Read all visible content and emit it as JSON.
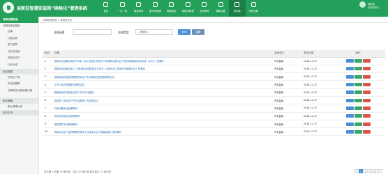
{
  "app": {
    "title": "吴新区智慧安监和“网格化”管理系统"
  },
  "nav": [
    {
      "label": "首页",
      "icon": "home-icon"
    },
    {
      "label": "一企一档",
      "icon": "building-icon"
    },
    {
      "label": "隐患排查",
      "icon": "search-icon"
    },
    {
      "label": "重大危险源",
      "icon": "warning-icon"
    },
    {
      "label": "网格巡查",
      "icon": "grid-icon"
    },
    {
      "label": "网格员管理",
      "icon": "users-icon"
    },
    {
      "label": "安全教育",
      "icon": "book-icon"
    },
    {
      "label": "辅助功能",
      "icon": "tools-icon"
    },
    {
      "label": "知识库",
      "icon": "library-icon",
      "active": true
    },
    {
      "label": "系统设置",
      "icon": "gear-icon"
    }
  ],
  "user": {
    "name": "吴新宏",
    "role": "系统管理员"
  },
  "sidebar": {
    "header": "法律法规标准",
    "groups": [
      {
        "label": "法规标准信息库",
        "items": [
          "法律",
          "行政法规",
          "部门规章",
          "地方性法规",
          "规范性文件",
          "行业标准"
        ]
      },
      {
        "label": "执法依据",
        "items": [
          "安全生产类",
          "执法依据类",
          "法律责任对照依据汇编"
        ]
      },
      {
        "label": "职业健康",
        "items": [
          "职业健康标准"
        ]
      },
      {
        "label": "执法文书",
        "items": []
      }
    ]
  },
  "breadcrumb": "法律法规标准 > 规范性文件",
  "search": {
    "label1": "法规标题：",
    "label2": "法规类型：",
    "select_value": "--请选择--",
    "query_label": "查询",
    "reset_label": "重置"
  },
  "table": {
    "headers": {
      "idx": "序号",
      "title": "标题",
      "dept": "发布部门",
      "date": "发布日期",
      "ops": "操作"
    },
    "rows": [
      {
        "idx": "1",
        "title": "国家安全监管总局关于印发《化工危险化学品生产经营单位重大生产安全事故隐患判定标准（试行）》的通知",
        "dept": "市安监局",
        "date": "2016-12-27"
      },
      {
        "idx": "2",
        "title": "国家安全监管总局 人力资源社会保障部关于印发《注册安全工程师分类管理办法》的通知",
        "dept": "市安监局",
        "date": "2016-12-27"
      },
      {
        "idx": "3",
        "title": "国家食品药品监督管理总局生产安全事故应急预案管理办法",
        "dept": "市安监局",
        "date": "2016-12-27"
      },
      {
        "idx": "4",
        "title": "中华人民共和国职业病防治法",
        "dept": "市安监局",
        "date": "2016-12-27"
      },
      {
        "idx": "5",
        "title": "国家危险化学品安全生产许可工作细则",
        "dept": "市安监局",
        "date": "2016-12-27"
      },
      {
        "idx": "6",
        "title": "国务院《安全生产许可证条例》的实施办法",
        "dept": "市安监局",
        "date": "2016-12-27"
      },
      {
        "idx": "7",
        "title": "特种设备安全监察条例",
        "dept": "市安监局",
        "date": "2016-12-27"
      },
      {
        "idx": "8",
        "title": "危险化学品安全管理条例",
        "dept": "市安监局",
        "date": "2016-12-27"
      },
      {
        "idx": "9",
        "title": "烟花爆竹安全管理条例",
        "dept": "市安监局",
        "date": "2016-12-27"
      },
      {
        "idx": "10",
        "title": "国家安全生产监督管理总局关于加强安全生产监管监察工作的通知",
        "dept": "市安监局",
        "date": "2016-12-27"
      }
    ]
  },
  "footer": {
    "text": "显示第 1 到第 10 条记录，总共 35 条记录 每页显示 10 条记录",
    "pages": [
      "‹",
      "1",
      "2",
      "3",
      "4",
      "›"
    ],
    "current_page": "1"
  }
}
